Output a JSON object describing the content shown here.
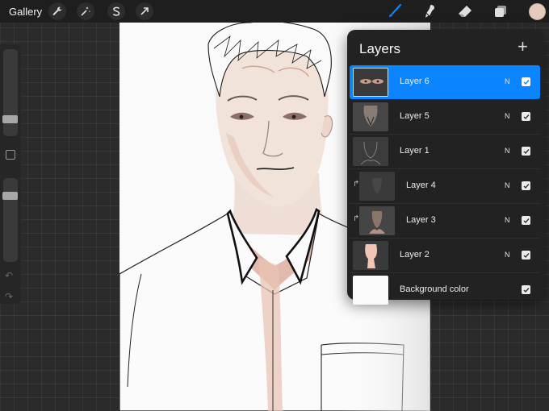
{
  "topbar": {
    "gallery_label": "Gallery"
  },
  "colors": {
    "accent": "#0a84ff",
    "current_color": "#e4cbbd"
  },
  "icons": {
    "left_tools": [
      "wrench-icon",
      "magic-wand-icon",
      "selection-icon",
      "move-arrow-icon"
    ],
    "right_tools": [
      "brush-icon",
      "smudge-icon",
      "eraser-icon",
      "layers-icon"
    ]
  },
  "layers_panel": {
    "title": "Layers",
    "add_label": "+",
    "layers": [
      {
        "name": "Layer 6",
        "blend": "N",
        "visible": true,
        "selected": true,
        "clipped": false
      },
      {
        "name": "Layer 5",
        "blend": "N",
        "visible": true,
        "selected": false,
        "clipped": false
      },
      {
        "name": "Layer 1",
        "blend": "N",
        "visible": true,
        "selected": false,
        "clipped": false
      },
      {
        "name": "Layer 4",
        "blend": "N",
        "visible": true,
        "selected": false,
        "clipped": true
      },
      {
        "name": "Layer 3",
        "blend": "N",
        "visible": true,
        "selected": false,
        "clipped": true
      },
      {
        "name": "Layer 2",
        "blend": "N",
        "visible": true,
        "selected": false,
        "clipped": false
      }
    ],
    "background": {
      "name": "Background color",
      "visible": true
    }
  }
}
